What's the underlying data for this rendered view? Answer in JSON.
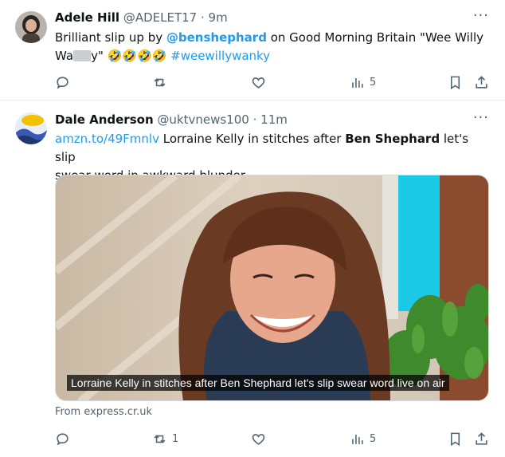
{
  "tweets": [
    {
      "author": {
        "name": "Adele Hill",
        "handle": "@ADELET17",
        "time": "9m"
      },
      "text": {
        "prefix": "Brilliant slip up by ",
        "mention": "@benshephard",
        "middle1": " on Good Morning Britain \"Wee Willy",
        "line2_start": "Wa",
        "line2_after": "y\" ",
        "emoji": "🤣🤣🤣🤣",
        "hashtag": "#weewillywanky"
      },
      "stats": {
        "views": "5"
      }
    },
    {
      "author": {
        "name": "Dale Anderson",
        "handle": "@uktvnews100",
        "time": "11m"
      },
      "text": {
        "link": "amzn.to/49Fmnlv",
        "part1": " Lorraine Kelly in stitches after ",
        "bold": "Ben Shephard",
        "part2": " let's slip",
        "line2": "swear word in awkward blunder"
      },
      "card": {
        "caption": "Lorraine Kelly in stitches after Ben Shephard let's slip swear word live on air",
        "source": "From express.cr.uk"
      },
      "stats": {
        "retweets": "1",
        "views": "5"
      }
    }
  ],
  "icons": [
    "more-icon",
    "reply-icon",
    "retweet-icon",
    "like-icon",
    "views-icon",
    "bookmark-icon",
    "share-icon"
  ],
  "colors": {
    "link": "#1d9bf0",
    "muted": "#536471",
    "text": "#0f1419"
  }
}
